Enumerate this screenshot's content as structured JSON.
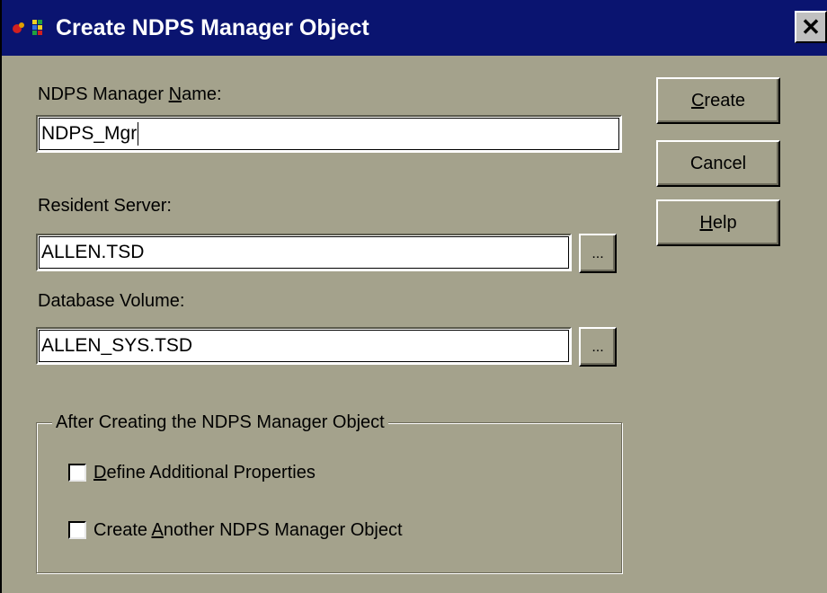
{
  "window": {
    "title": "Create NDPS Manager Object",
    "close_label": "✕"
  },
  "form": {
    "manager_name": {
      "label_pre": "NDPS Manager ",
      "label_accel": "N",
      "label_post": "ame:",
      "value": "NDPS_Mgr"
    },
    "resident_server": {
      "label": "Resident Server:",
      "value": "ALLEN.TSD",
      "browse_label": "..."
    },
    "database_volume": {
      "label": "Database Volume:",
      "value": "ALLEN_SYS.TSD",
      "browse_label": "..."
    }
  },
  "buttons": {
    "create": {
      "accel": "C",
      "rest": "reate"
    },
    "cancel": {
      "label": "Cancel"
    },
    "help": {
      "accel": "H",
      "rest": "elp"
    }
  },
  "after_group": {
    "legend": "After Creating the NDPS Manager Object",
    "options": [
      {
        "pre": "",
        "accel": "D",
        "post": "efine Additional Properties",
        "checked": false
      },
      {
        "pre": "Create ",
        "accel": "A",
        "post": "nother NDPS Manager Object",
        "checked": false
      }
    ]
  },
  "colors": {
    "titlebar": "#0a1470",
    "face": "#a4a28c"
  }
}
